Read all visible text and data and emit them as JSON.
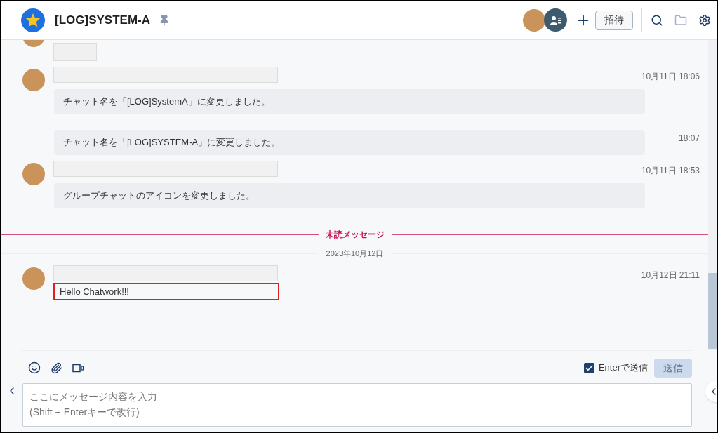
{
  "header": {
    "title": "[LOG]SYSTEM-A",
    "pinned": true,
    "invite_button": "招待"
  },
  "messages": [
    {
      "kind": "cut"
    },
    {
      "kind": "system",
      "time": "10月11日 18:06",
      "text": "チャット名を「[LOG]SystemA」に変更しました。"
    },
    {
      "kind": "continuation",
      "time": "18:07",
      "text": "チャット名を「[LOG]SYSTEM-A」に変更しました。"
    },
    {
      "kind": "system",
      "time": "10月11日 18:53",
      "text": "グループチャットのアイコンを変更しました。"
    },
    {
      "kind": "divider",
      "text": "未読メッセージ"
    },
    {
      "kind": "date",
      "text": "2023年10月12日"
    },
    {
      "kind": "plain",
      "time": "10月12日 21:11",
      "text": "Hello Chatwork!!!",
      "highlighted": true
    }
  ],
  "composer": {
    "enter_to_send": {
      "label": "Enterで送信",
      "checked": true
    },
    "send_button": {
      "label": "送信",
      "disabled": true
    },
    "placeholder": "ここにメッセージ内容を入力\n(Shift + Enterキーで改行)"
  }
}
